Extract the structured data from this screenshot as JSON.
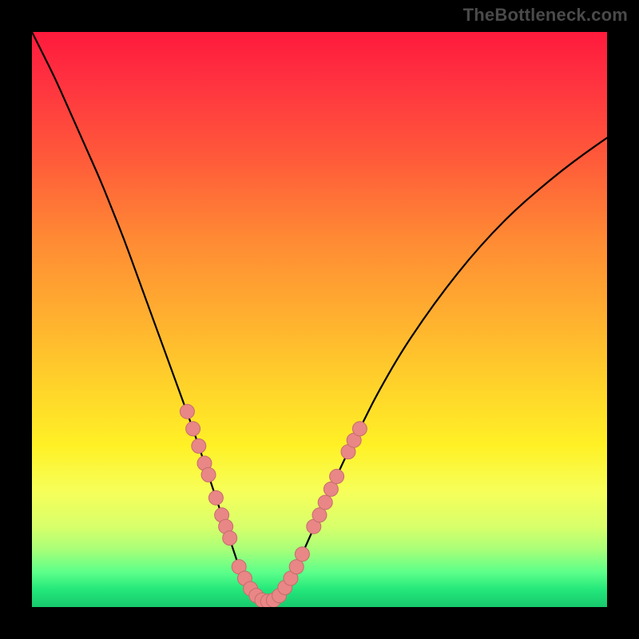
{
  "watermark": "TheBottleneck.com",
  "colors": {
    "page_bg": "#000000",
    "curve": "#000000",
    "dot_fill": "#e98686",
    "dot_stroke": "#c46d6d",
    "gradient_top": "#ff1a3c",
    "gradient_bottom": "#18c96d"
  },
  "chart_data": {
    "type": "line",
    "title": "",
    "xlabel": "",
    "ylabel": "",
    "xlim": [
      0,
      100
    ],
    "ylim": [
      0,
      100
    ],
    "x": [
      0,
      2,
      4,
      6,
      8,
      10,
      12,
      14,
      16,
      18,
      20,
      22,
      24,
      26,
      28,
      30,
      31,
      32,
      33,
      34,
      35,
      36,
      37,
      38,
      39,
      40,
      41,
      42,
      43,
      44,
      46,
      48,
      50,
      52,
      54,
      56,
      58,
      60,
      64,
      68,
      72,
      76,
      80,
      84,
      88,
      92,
      96,
      100
    ],
    "series": [
      {
        "name": "bottleneck-curve",
        "values": [
          100,
          96,
          92,
          87.5,
          83,
          78.5,
          74,
          69,
          64,
          58.5,
          53,
          47.5,
          42,
          36.5,
          31,
          25,
          22,
          19,
          16,
          13,
          10,
          7,
          5,
          3.2,
          2,
          1.2,
          1,
          1.2,
          2,
          3.4,
          7,
          11.5,
          16,
          20.5,
          25,
          29,
          33,
          37,
          44,
          50,
          55.5,
          60.5,
          65,
          69,
          72.5,
          75.8,
          78.8,
          81.6
        ]
      }
    ],
    "markers": {
      "name": "highlight-dots",
      "points": [
        {
          "x": 27,
          "y": 34
        },
        {
          "x": 28,
          "y": 31
        },
        {
          "x": 29,
          "y": 28
        },
        {
          "x": 30,
          "y": 25
        },
        {
          "x": 30.7,
          "y": 23
        },
        {
          "x": 32,
          "y": 19
        },
        {
          "x": 33,
          "y": 16
        },
        {
          "x": 33.7,
          "y": 14
        },
        {
          "x": 34.4,
          "y": 12
        },
        {
          "x": 36,
          "y": 7
        },
        {
          "x": 37,
          "y": 5
        },
        {
          "x": 38,
          "y": 3.2
        },
        {
          "x": 39,
          "y": 2
        },
        {
          "x": 40,
          "y": 1.2
        },
        {
          "x": 41,
          "y": 1
        },
        {
          "x": 42,
          "y": 1.2
        },
        {
          "x": 43,
          "y": 2
        },
        {
          "x": 44,
          "y": 3.4
        },
        {
          "x": 45,
          "y": 5
        },
        {
          "x": 46,
          "y": 7
        },
        {
          "x": 47,
          "y": 9.2
        },
        {
          "x": 49,
          "y": 14
        },
        {
          "x": 50,
          "y": 16
        },
        {
          "x": 51,
          "y": 18.2
        },
        {
          "x": 52,
          "y": 20.5
        },
        {
          "x": 53,
          "y": 22.7
        },
        {
          "x": 55,
          "y": 27
        },
        {
          "x": 56,
          "y": 29
        },
        {
          "x": 57,
          "y": 31
        }
      ]
    }
  }
}
